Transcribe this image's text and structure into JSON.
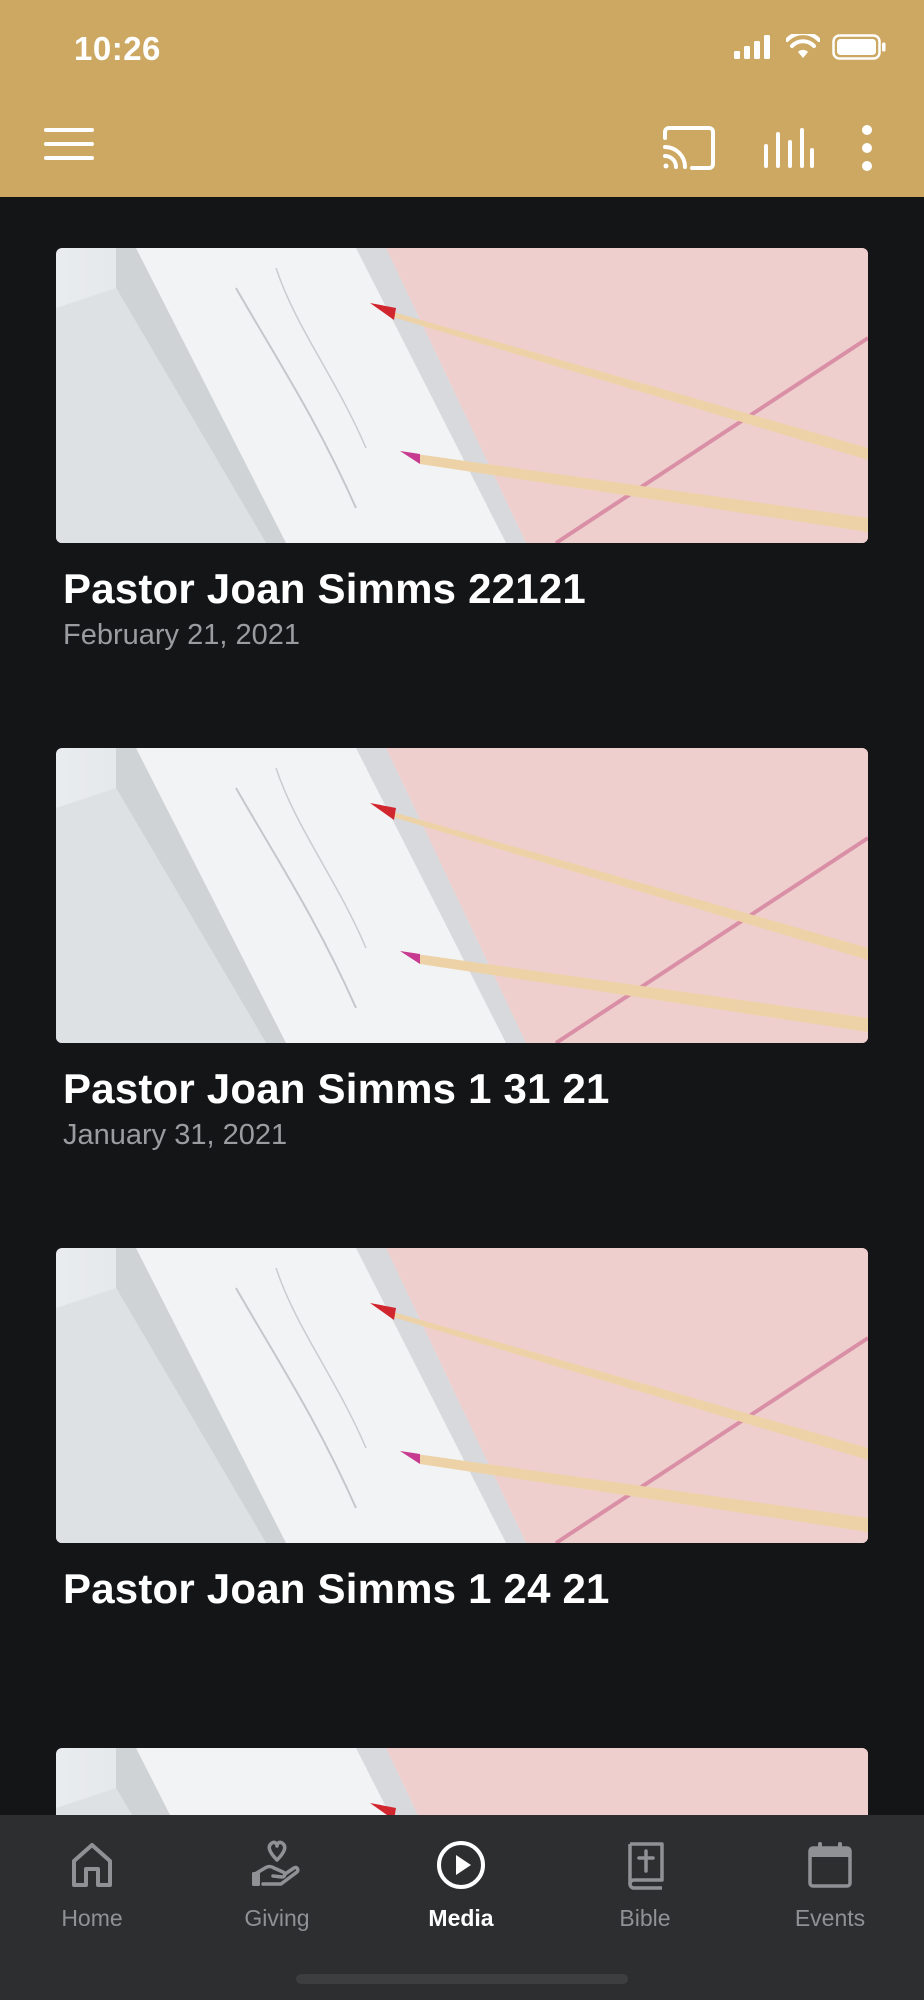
{
  "status_bar": {
    "time": "10:26"
  },
  "app_bar": {
    "menu_icon": "hamburger-menu-icon",
    "cast_icon": "cast-icon",
    "audio_icon": "equalizer-icon",
    "more_icon": "more-vertical-icon"
  },
  "colors": {
    "accent": "#CCA862",
    "background": "#141517",
    "tabbar": "#2d2e30"
  },
  "feed": {
    "items": [
      {
        "title": "Pastor Joan Simms 22121",
        "date": "February 21, 2021"
      },
      {
        "title": "Pastor Joan Simms 1 31 21",
        "date": "January 31, 2021"
      },
      {
        "title": "Pastor Joan Simms 1 24 21",
        "date": ""
      },
      {
        "title": "",
        "date": ""
      }
    ]
  },
  "tabs": [
    {
      "label": "Home",
      "icon": "home-icon",
      "active": false
    },
    {
      "label": "Giving",
      "icon": "giving-hand-heart-icon",
      "active": false
    },
    {
      "label": "Media",
      "icon": "play-circle-icon",
      "active": true
    },
    {
      "label": "Bible",
      "icon": "bible-icon",
      "active": false
    },
    {
      "label": "Events",
      "icon": "calendar-icon",
      "active": false
    }
  ]
}
